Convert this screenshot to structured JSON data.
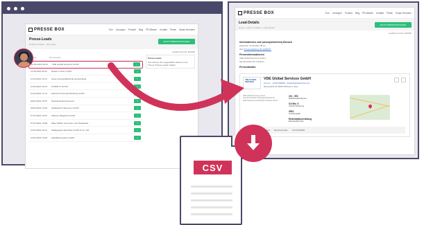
{
  "colors": {
    "accent": "#d0335a",
    "frame": "#4a4868",
    "cta_green": "#2bbf7a"
  },
  "left_window": {
    "logo": "PRESSE BOX",
    "nav": [
      "Tour",
      "Lösungen",
      "Produkt",
      "Blog",
      "PR-Wissen",
      "Kontakt",
      "Preise",
      "Susan Hermann"
    ],
    "page_title": "Presse-Leads",
    "breadcrumb": "Details anzeigen · alle Leads",
    "cta_label": "JETZT PREMIUM BUCHEN",
    "limit_text": "Leadlimit erreicht: 600/600",
    "list_headers": [
      "Datum",
      "Firmenname"
    ],
    "rows": [
      {
        "date": "11.03.2021 08:13",
        "company": "VDE Global Services GmbH",
        "selected": true
      },
      {
        "date": "11.03.2021 09:44",
        "company": "Robert Locher GmbH",
        "selected": false
      },
      {
        "date": "11.03.2021 12:13",
        "company": "Grote Kunststofftechnik Deutschland",
        "selected": false
      },
      {
        "date": "11.03.2021 16:13",
        "company": "D.KRID IT GmbH",
        "selected": false
      },
      {
        "date": "11.03.2021 17:13",
        "company": "Zeitrohr & Freund Hamburg GmbH",
        "selected": false
      },
      {
        "date": "08.03.2021 15:57",
        "company": "Haupttechnik Dortmund",
        "selected": false
      },
      {
        "date": "08.03.2021 12:30",
        "company": "Stadtwerke Hannover GmbH",
        "selected": false
      },
      {
        "date": "07.03.2021 10:31",
        "company": "Alliance Plugtools GmbH",
        "selected": false
      },
      {
        "date": "07.03.2021 14:58",
        "company": "Maier Möller Konsorten und Handelsfix",
        "selected": false
      },
      {
        "date": "22.04.2021 11:22",
        "company": "Stahlgruppe Wohnbau GmbH & Co. KG",
        "selected": false
      },
      {
        "date": "22.04.2021 14:09",
        "company": "AllwoBetonwerks GmbH",
        "selected": false
      }
    ],
    "side_box": {
      "title": "Presse-Leads",
      "text": "Hier können Sie ausgewählte Aktionen zum Thema 'Presse-Leads' wählen"
    }
  },
  "right_window": {
    "logo": "PRESSE BOX",
    "nav": [
      "Tour",
      "Lösungen",
      "Produkt",
      "Blog",
      "PR-Wissen",
      "Kontakt",
      "Preise",
      "Susan Hermann"
    ],
    "page_title": "Lead-Details",
    "breadcrumb": "Home › Leads verwalten › Lead Details",
    "cta_label": "JETZT PREMIUM BUCHEN",
    "limit_text": "Leadlimit erreicht: 600/600",
    "section_visit": "Informationen zum (anonymisierten) Besuch",
    "visit_date": "Zeitpunkt: 12.03.2021 08:13",
    "visit_link_prefix": "Ziel:",
    "visit_link": "Pressemitteilung-ID 12345XY",
    "section_company_name": "Firmeninformationen",
    "company_line1": "VDE Global Services GmbH",
    "company_line2": "Merianstraße 28, Frankfurt",
    "section_details": "Firmendetails",
    "company": {
      "name": "VDE Global Services GmbH",
      "logo_text": "VDE GLOBAL SERVICES",
      "meta": "vde.com · +49 69 6308284 · info@vdeglobalservices.com",
      "address": "Merianstraße 28, 63069 Offenbach a. Main",
      "desc": "VDE Global Services ist eine Kundenorientierte Tochtergesellschaft der VDE Testing and Certification Institute GmbH",
      "stats": [
        {
          "key": "101 - 500",
          "label": "Mitarbeiter/Employees"
        },
        {
          "key": "5,9 Mio. €",
          "label": "Umsatz Schätzung"
        },
        {
          "key": "2003",
          "label": "Gründungsjahr"
        },
        {
          "key": "Elektrizitätsverteilung",
          "label": "Branche/WZ-Code"
        }
      ],
      "strip": [
        "0,8 Mio. € Umsatz",
        "Branchenkontakt",
        "+49 69 6308284"
      ]
    }
  },
  "export": {
    "badge": "CSV",
    "icon": "download-arrow-icon"
  }
}
